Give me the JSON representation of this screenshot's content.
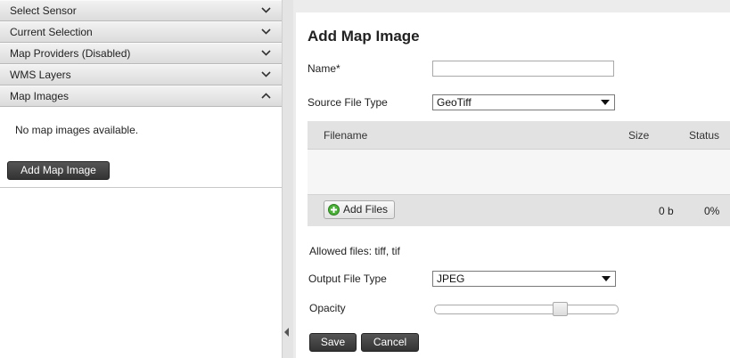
{
  "sidebar": {
    "sections": [
      {
        "label": "Select Sensor",
        "expanded": false
      },
      {
        "label": "Current Selection",
        "expanded": false
      },
      {
        "label": "Map Providers (Disabled)",
        "expanded": false
      },
      {
        "label": "WMS Layers",
        "expanded": false
      },
      {
        "label": "Map Images",
        "expanded": true
      }
    ],
    "map_images": {
      "empty_text": "No map images available.",
      "add_button_label": "Add Map Image"
    }
  },
  "form": {
    "title": "Add Map Image",
    "name_label": "Name*",
    "name_value": "",
    "source_type_label": "Source File Type",
    "source_type_value": "GeoTiff",
    "uploader": {
      "col_filename": "Filename",
      "col_size": "Size",
      "col_status": "Status",
      "add_files_label": "Add Files",
      "total_size": "0 b",
      "total_status": "0%"
    },
    "allowed_files": "Allowed files: tiff, tif",
    "output_type_label": "Output File Type",
    "output_type_value": "JPEG",
    "opacity_label": "Opacity",
    "opacity_value": 0.7,
    "save_label": "Save",
    "cancel_label": "Cancel"
  },
  "colors": {
    "dark_button": "#3c3c3c",
    "header_gray": "#e2e2e2",
    "add_icon_green": "#4caf3a"
  }
}
